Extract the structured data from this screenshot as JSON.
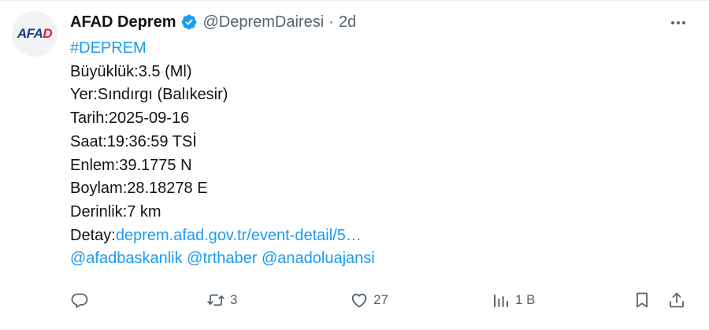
{
  "tweet": {
    "author": {
      "avatar_text": "AFAD",
      "name": "AFAD Deprem",
      "handle": "@DepremDairesi",
      "separator": "·",
      "time": "2d"
    },
    "lines": {
      "hashtag": "#DEPREM",
      "magnitude": "Büyüklük:3.5 (Ml)",
      "location": "Yer:Sındırgı (Balıkesir)",
      "date": "Tarih:2025-09-16",
      "time": "Saat:19:36:59 TSİ",
      "latitude": "Enlem:39.1775 N",
      "longitude": "Boylam:28.18278 E",
      "depth": "Derinlik:7 km",
      "detail_label": "Detay:",
      "detail_link": "deprem.afad.gov.tr/event-detail/5…",
      "mention_1": "@afadbaskanlik",
      "mention_2": "@trthaber",
      "mention_3": "@anadoluajansi"
    },
    "actions": {
      "replies": "",
      "retweets": "3",
      "likes": "27",
      "views": "1 B"
    }
  },
  "colors": {
    "link": "#1d9bf0",
    "secondary_text": "#536471",
    "verified_badge": "#1d9bf0"
  },
  "icons": [
    "verified-badge-icon",
    "more-icon",
    "reply-icon",
    "retweet-icon",
    "like-icon",
    "views-icon",
    "bookmark-icon",
    "share-icon"
  ]
}
